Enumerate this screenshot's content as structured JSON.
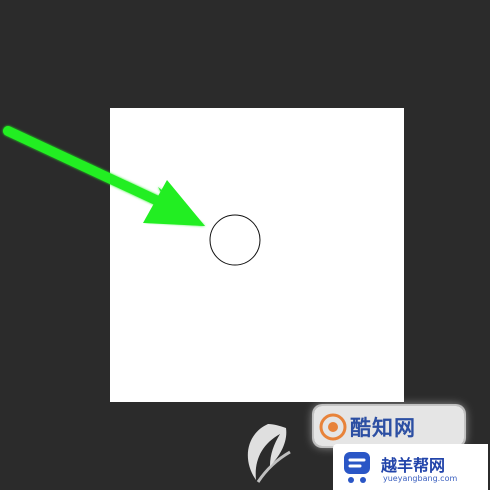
{
  "canvas": {
    "background_color": "#2b2b2b",
    "document_color": "#ffffff"
  },
  "annotation": {
    "arrow_color": "#22ee22",
    "arrow_icon": "arrow-icon",
    "circle_icon": "circle-icon"
  },
  "watermarks": {
    "wm1_text": "酷知网",
    "wm2_text": "越羊帮网",
    "wm2_domain": "yueyangbang.com"
  }
}
